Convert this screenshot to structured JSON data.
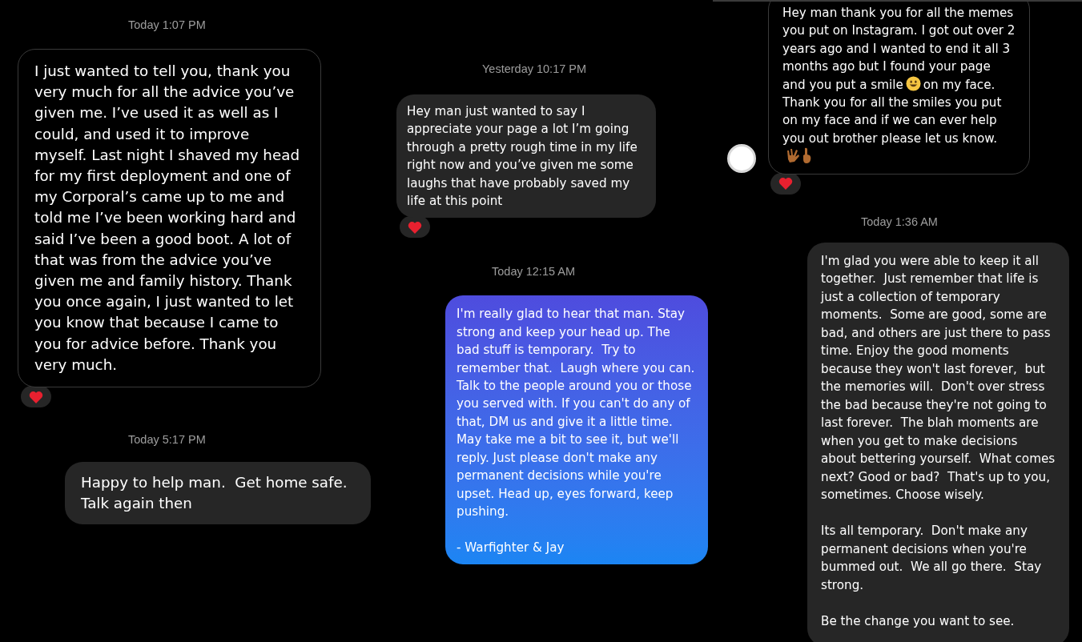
{
  "panels": [
    {
      "items": [
        {
          "kind": "timestamp",
          "text": "Today 1:07 PM"
        },
        {
          "kind": "message",
          "avatar": false,
          "reaction": true,
          "segments": [
            {
              "kind": "text",
              "text": "I just wanted to tell you, thank you very much for all the advice you’ve given me. I’ve used it as well as I could, and used it to improve myself. Last night I shaved my head for my first deployment and one of my Corporal’s came up to me and told me I’ve been working hard and said I’ve been a good boot. A lot of that was from the advice you’ve given me and family history. Thank you once again, I just wanted to let you know that because I came to you for advice before. Thank you very much."
            }
          ]
        },
        {
          "kind": "timestamp",
          "text": "Today 5:17 PM"
        },
        {
          "kind": "message",
          "avatar": false,
          "reaction": false,
          "segments": [
            {
              "kind": "text",
              "text": "Happy to help man.  Get home safe. Talk again then"
            }
          ]
        }
      ]
    },
    {
      "items": [
        {
          "kind": "timestamp",
          "text": "Yesterday 10:17 PM"
        },
        {
          "kind": "message",
          "avatar": false,
          "reaction": true,
          "segments": [
            {
              "kind": "text",
              "text": "Hey man just wanted to say I appreciate your page a lot I’m going through a pretty rough time in my life right now and you’ve given me some laughs that have probably saved my life at this point"
            }
          ]
        },
        {
          "kind": "timestamp",
          "text": "Today 12:15 AM"
        },
        {
          "kind": "message",
          "avatar": false,
          "reaction": false,
          "segments": [
            {
              "kind": "text",
              "text": "I'm really glad to hear that man. Stay strong and keep your head up. The bad stuff is temporary.  Try to remember that.  Laugh where you can. Talk to the people around you or those you served with. If you can't do any of that, DM us and give it a little time. May take me a bit to see it, but we'll reply. Just please don't make any permanent decisions while you're upset. Head up, eyes forward, keep pushing.\n\n- Warfighter & Jay"
            }
          ]
        }
      ]
    },
    {
      "items": [
        {
          "kind": "message",
          "avatar": true,
          "reaction": true,
          "segments": [
            {
              "kind": "text",
              "text": "Hey man thank you for all the memes you put on Instagram. I got out over 2 years ago and I wanted to end it all 3 months ago but I found your page and you put a smile"
            },
            {
              "kind": "smile"
            },
            {
              "kind": "text",
              "text": "on my face. Thank you for all the smiles you put on my face and if we can ever help you out brother please let us know."
            },
            {
              "kind": "hands"
            }
          ]
        },
        {
          "kind": "timestamp",
          "text": "Today 1:36 AM"
        },
        {
          "kind": "message",
          "avatar": false,
          "reaction": false,
          "segments": [
            {
              "kind": "text",
              "text": "I'm glad you were able to keep it all together.  Just remember that life is just a collection of temporary moments.  Some are good, some are bad, and others are just there to pass time. Enjoy the good moments because they won't last forever,  but the memories will.  Don't over stress the bad because they're not going to last forever.  The blah moments are when you get to make decisions about bettering yourself.  What comes next? Good or bad?  That's up to you, sometimes. Choose wisely.\n\nIts all temporary.  Don't make any permanent decisions when you're bummed out.  We all go there.  Stay strong.\n\nBe the change you want to see."
            }
          ]
        }
      ]
    }
  ]
}
